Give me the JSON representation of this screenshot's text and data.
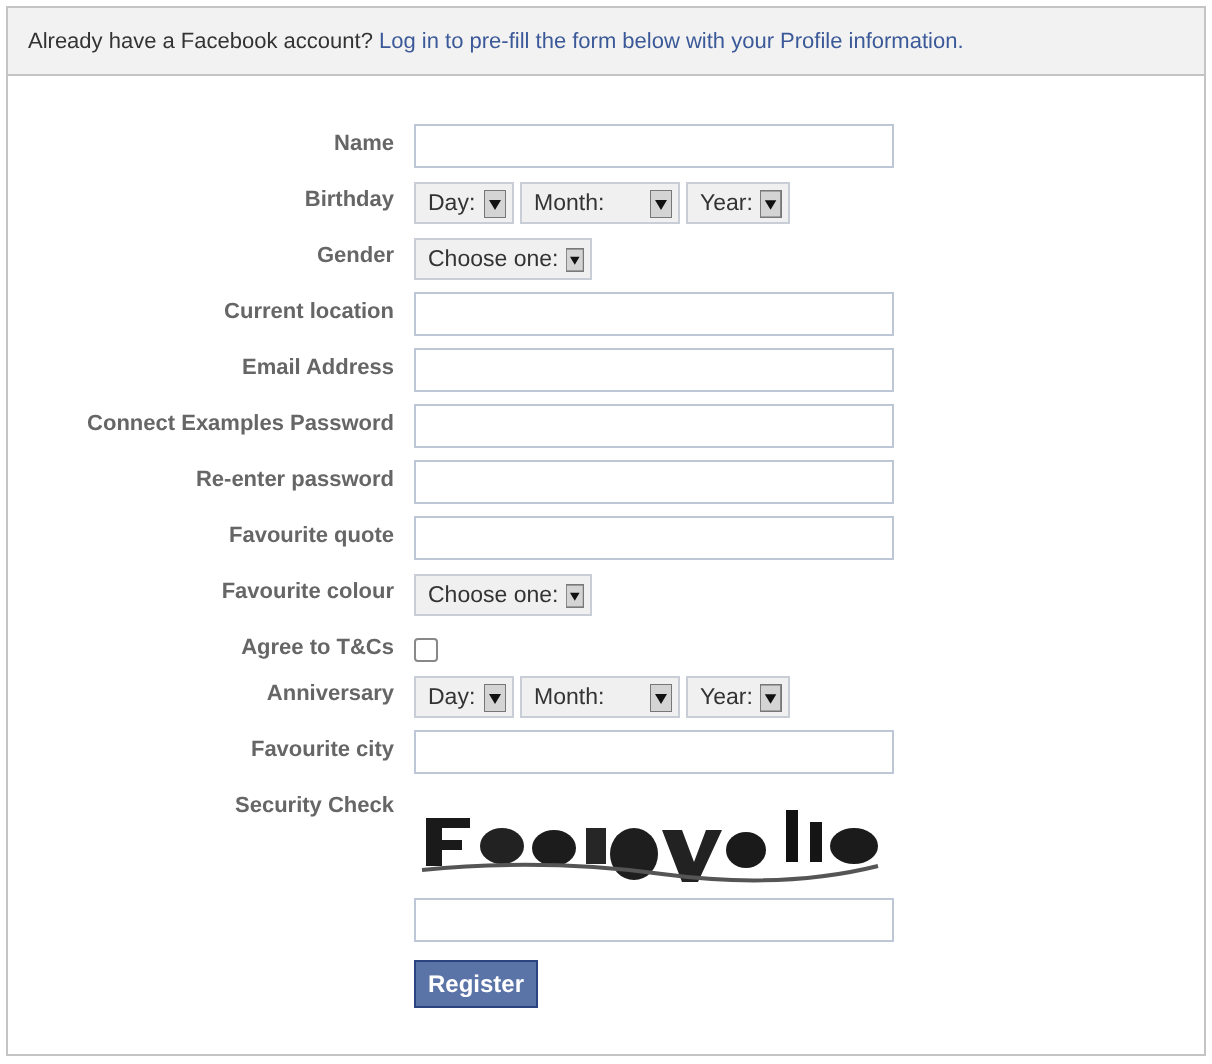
{
  "notice": {
    "text": "Already have a Facebook account?",
    "link": "Log in to pre-fill the form below with your Profile information."
  },
  "rows": [
    {
      "label": "Name",
      "kind": "text"
    },
    {
      "label": "Birthday",
      "kind": "select",
      "selects": [
        "Day:",
        "Month:",
        "Year:"
      ]
    },
    {
      "label": "Gender",
      "kind": "select",
      "selects": [
        "Choose one:"
      ]
    },
    {
      "label": "Current location",
      "kind": "text"
    },
    {
      "label": "Email Address",
      "kind": "text"
    },
    {
      "label": "Connect Examples Password",
      "kind": "text"
    },
    {
      "label": "Re-enter password",
      "kind": "text"
    },
    {
      "label": "Favourite quote",
      "kind": "text"
    },
    {
      "label": "Favourite colour",
      "kind": "select",
      "selects": [
        "Choose one:"
      ]
    },
    {
      "label": "Agree to T&Cs",
      "kind": "checkbox",
      "checked": false
    },
    {
      "label": "Anniversary",
      "kind": "select",
      "selects": [
        "Day:",
        "Month:",
        "Year:"
      ]
    },
    {
      "label": "Favourite city",
      "kind": "text"
    },
    {
      "label": "Security Check",
      "kind": "captcha"
    }
  ],
  "submit": "Register"
}
